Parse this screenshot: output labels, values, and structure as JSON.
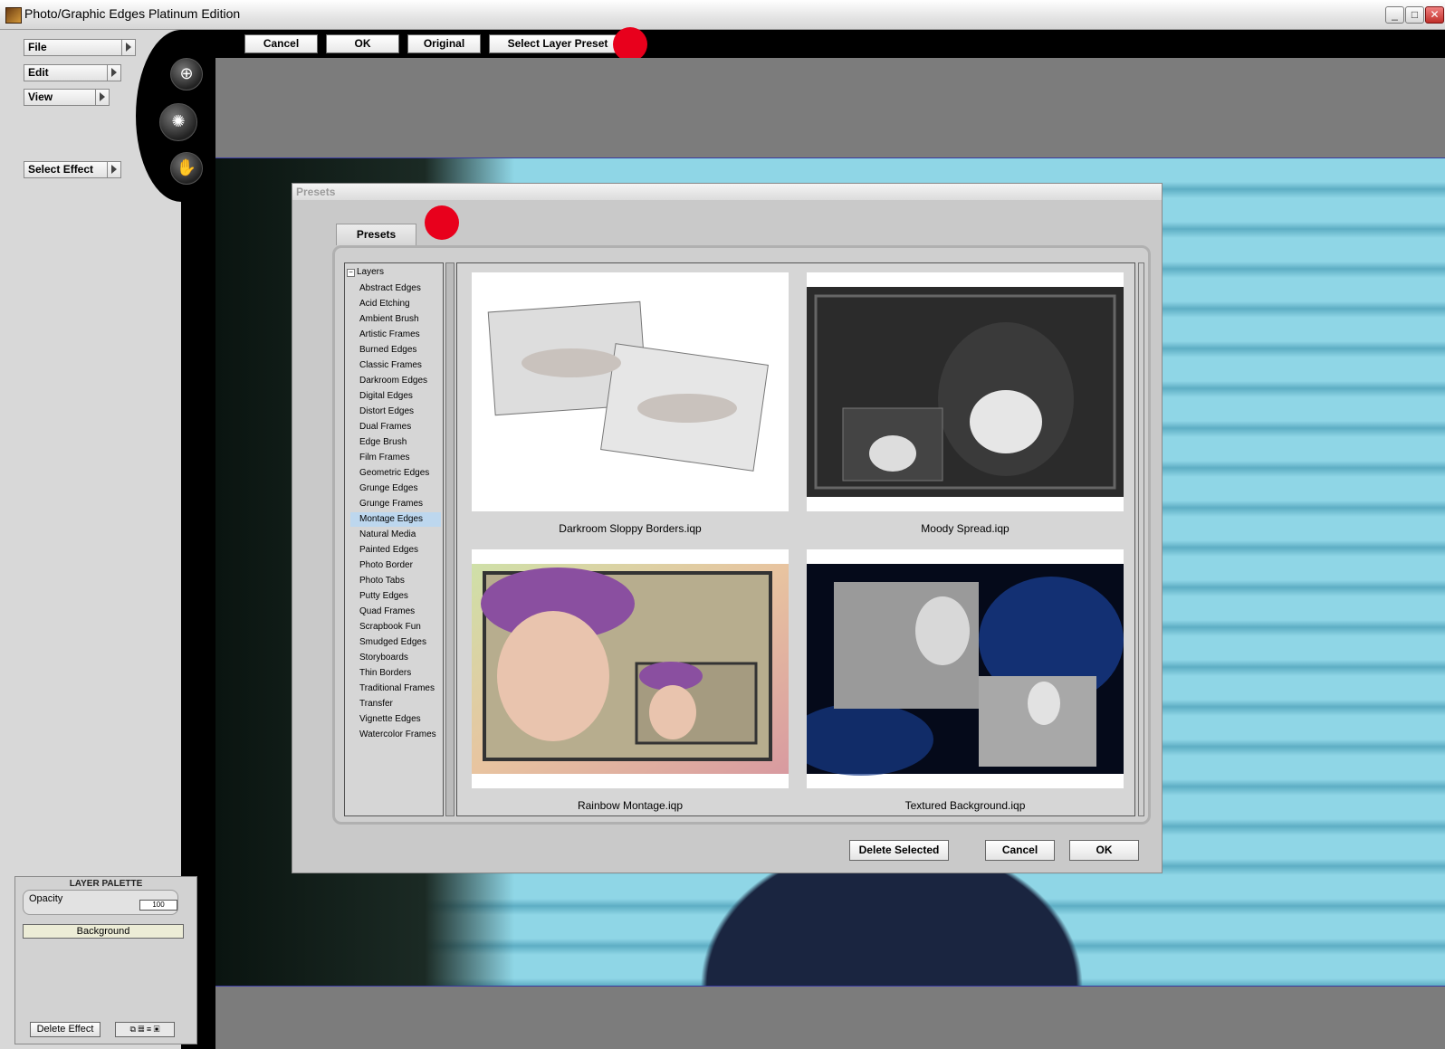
{
  "window": {
    "title": "Photo/Graphic Edges Platinum Edition",
    "controls": {
      "minimize": "_",
      "maximize": "□",
      "close": "✕"
    }
  },
  "left_menu": {
    "file": "File",
    "edit": "Edit",
    "view": "View",
    "select_effect": "Select Effect"
  },
  "tools": {
    "zoom": "zoom-icon",
    "brush": "brush-icon",
    "hand": "hand-icon"
  },
  "toolbar": {
    "cancel": "Cancel",
    "ok": "OK",
    "original": "Original",
    "select_layer_preset": "Select Layer Preset"
  },
  "presets_dialog": {
    "title": "Presets",
    "tab": "Presets",
    "tree_root": "Layers",
    "categories": [
      "Abstract Edges",
      "Acid Etching",
      "Ambient Brush",
      "Artistic Frames",
      "Burned Edges",
      "Classic Frames",
      "Darkroom Edges",
      "Digital Edges",
      "Distort Edges",
      "Dual Frames",
      "Edge Brush",
      "Film Frames",
      "Geometric Edges",
      "Grunge Edges",
      "Grunge Frames",
      "Montage Edges",
      "Natural Media",
      "Painted Edges",
      "Photo Border",
      "Photo Tabs",
      "Putty Edges",
      "Quad Frames",
      "Scrapbook Fun",
      "Smudged Edges",
      "Storyboards",
      "Thin Borders",
      "Traditional Frames",
      "Transfer",
      "Vignette Edges",
      "Watercolor Frames"
    ],
    "selected_category": "Montage Edges",
    "thumbnails": [
      "Darkroom Sloppy Borders.iqp",
      "Moody Spread.iqp",
      "Rainbow Montage.iqp",
      "Textured Background.iqp"
    ],
    "buttons": {
      "delete_selected": "Delete Selected",
      "cancel": "Cancel",
      "ok": "OK"
    }
  },
  "layer_palette": {
    "title": "LAYER PALETTE",
    "opacity_label": "Opacity",
    "opacity_value": "100",
    "layer_name": "Background",
    "delete_effect": "Delete Effect"
  },
  "colors": {
    "highlight_dot": "#e8001c",
    "selection": "#bdd7ee"
  }
}
